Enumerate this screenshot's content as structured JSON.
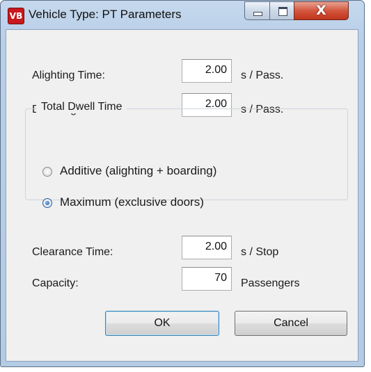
{
  "window": {
    "title": "Vehicle Type: PT Parameters",
    "icon": "vissim-app-icon",
    "icon_text": "VB"
  },
  "titlebar_buttons": {
    "minimize_icon": "minimize-icon",
    "maximize_icon": "maximize-icon",
    "close_icon": "close-icon",
    "close_glyph": "X"
  },
  "fields": {
    "alighting": {
      "label": "Alighting Time:",
      "value": "2.00",
      "unit": "s / Pass."
    },
    "boarding": {
      "label": "Boarding Time:",
      "value": "2.00",
      "unit": "s / Pass."
    },
    "clearance": {
      "label": "Clearance Time:",
      "value": "2.00",
      "unit": "s / Stop"
    },
    "capacity": {
      "label": "Capacity:",
      "value": "70",
      "unit": "Passengers"
    }
  },
  "dwell": {
    "title": "Total Dwell Time",
    "options": [
      {
        "label": "Additive (alighting + boarding)",
        "checked": false
      },
      {
        "label": "Maximum (exclusive doors)",
        "checked": true
      }
    ]
  },
  "buttons": {
    "ok": "OK",
    "cancel": "Cancel"
  },
  "colors": {
    "close_button": "#c8361f",
    "selected_radio": "#1b5cb0",
    "default_button_border": "#3c7fb1"
  }
}
